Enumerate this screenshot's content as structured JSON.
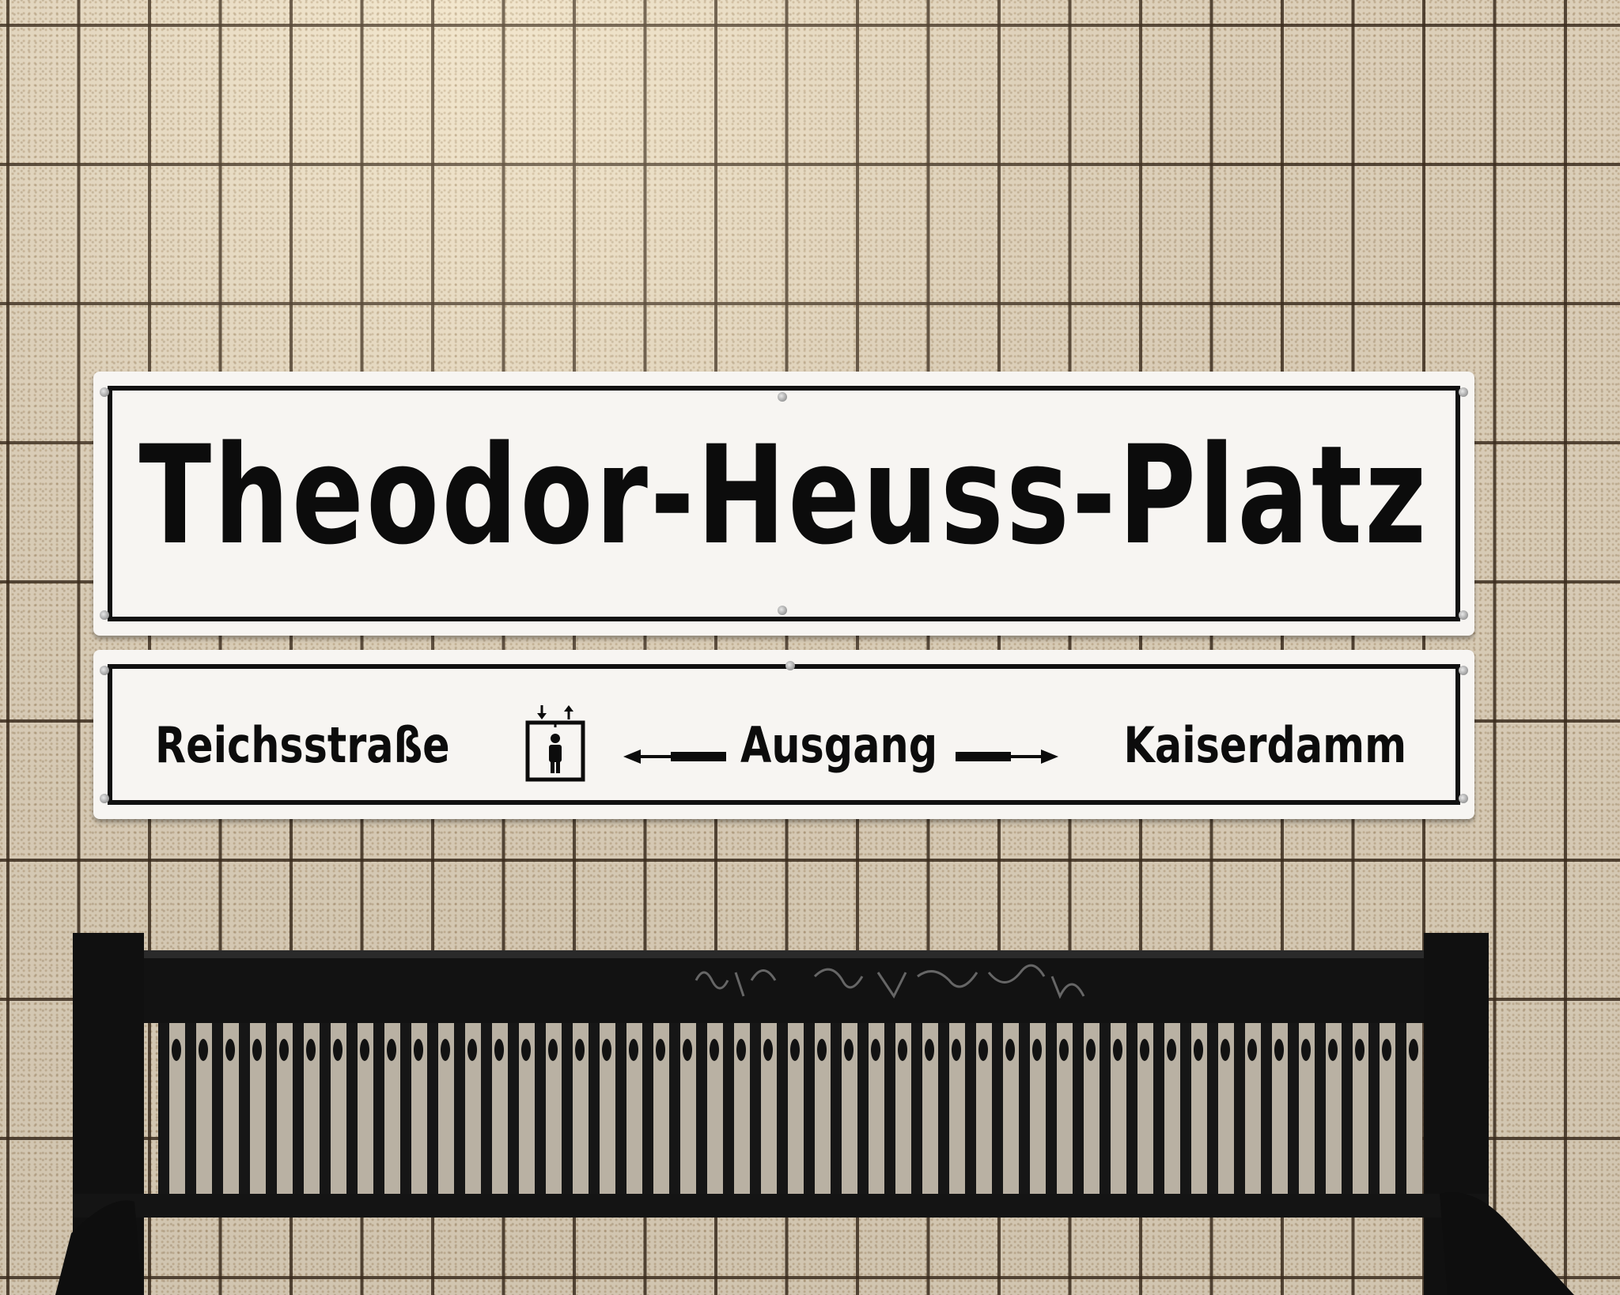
{
  "station_sign": {
    "name": "Theodor-Heuss-Platz"
  },
  "direction_sign": {
    "left_destination": "Reichsstraße",
    "center_label": "Ausgang",
    "right_destination": "Kaiserdamm",
    "icons": [
      "elevator-icon",
      "arrow-left-icon",
      "arrow-right-icon"
    ]
  },
  "bench_graffiti": "HSV SLACKS SHEIKO",
  "colors": {
    "sign_background": "#f7f5f2",
    "sign_text": "#0c0c0c",
    "tile": "#dccfb9",
    "bench": "#121212"
  }
}
